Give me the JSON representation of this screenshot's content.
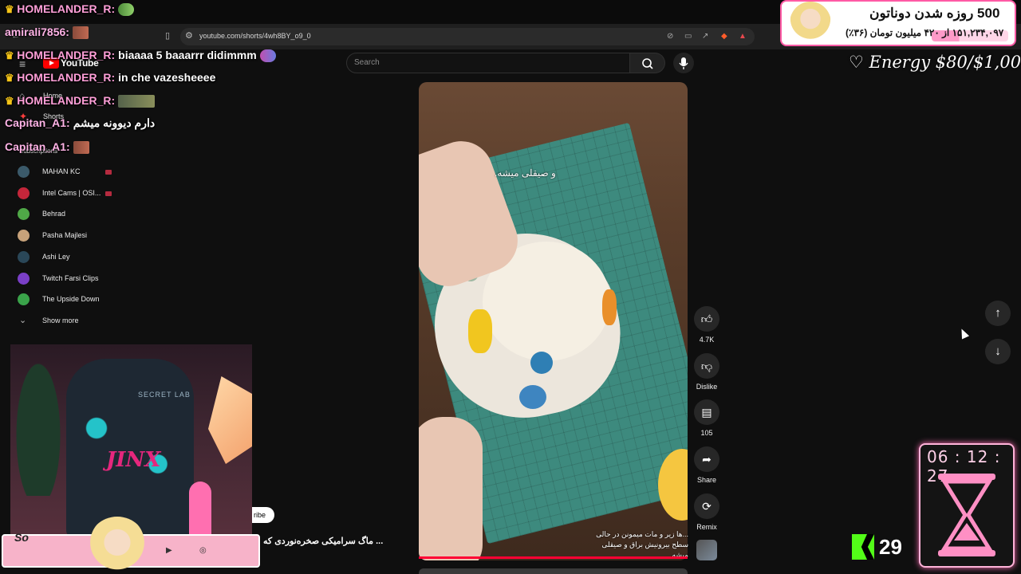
{
  "browser": {
    "tab_title": "(1) ماگ سرامیکی صخره‌نوردی",
    "url": "youtube.com/shorts/4wh8BY_o9_0"
  },
  "youtube": {
    "logo_text": "YouTube",
    "search_placeholder": "Search",
    "sidebar": {
      "home": "Home",
      "shorts": "Shorts",
      "subscriptions_heading": "Subscriptions",
      "subscriptions": [
        {
          "name": "MAHAN KC",
          "avatar_color": "#3b5a6a",
          "live": true
        },
        {
          "name": "Intel Cams | OSI...",
          "avatar_color": "#c4263a",
          "live": true
        },
        {
          "name": "Behrad",
          "avatar_color": "#4fa847",
          "live": false
        },
        {
          "name": "Pasha Majlesi",
          "avatar_color": "#c7a27a",
          "live": false
        },
        {
          "name": "Ashi Ley",
          "avatar_color": "#2a4758",
          "live": false
        },
        {
          "name": "Twitch Farsi Clips",
          "avatar_color": "#7a3fc7",
          "live": false
        },
        {
          "name": "The Upside Down",
          "avatar_color": "#3aa34a",
          "live": false
        }
      ],
      "show_more": "Show more"
    },
    "video": {
      "caption": "و صیقلی میشه.",
      "description": "...ها زیر و مات میمونن در حالی سطح بیرونیش براق و صیقلی میشه",
      "channel_title": "... ماگ سرامیکی صخره‌نوردی که"
    },
    "actions": {
      "likes": "4.7K",
      "dislike": "Dislike",
      "comments": "105",
      "share": "Share",
      "remix": "Remix"
    },
    "subscribe_fragment": "ribe"
  },
  "chat": [
    {
      "user": "HOMELANDER_R:",
      "message": "",
      "crown": true,
      "emote": "frog"
    },
    {
      "user": "amirali7856:",
      "message": "",
      "crown": false,
      "emote": "small"
    },
    {
      "user": "HOMELANDER_R:",
      "message": "biaaaa 5 baaarrr didimmm",
      "crown": true,
      "emote": "anime"
    },
    {
      "user": "HOMELANDER_R:",
      "message": "in che vazesheeee",
      "crown": true,
      "emote": ""
    },
    {
      "user": "HOMELANDER_R:",
      "message": "",
      "crown": true,
      "emote": "wide"
    },
    {
      "user": "Capitan_A1:",
      "message": "دارم دیوونه میشم",
      "crown": false,
      "emote": ""
    },
    {
      "user": "Capitan_A1:",
      "message": "",
      "crown": false,
      "emote": "small"
    }
  ],
  "donation": {
    "title": "500 روزه شدن دوناتون",
    "subtitle": "۱۵۱,۲۳۴,۰۹۷ از ۴۲۰ میلیون تومان (۳۶٪)",
    "goal_fraction": 0.36,
    "energy": "♡ Energy $80/$1,000"
  },
  "timer": {
    "time": "06 : 12 : 27"
  },
  "kick": {
    "viewer_count": "29"
  },
  "webcam": {
    "chair_brand": "SECRET LAB",
    "chair_text": "JINX"
  },
  "social": {
    "text": "So"
  },
  "colors": {
    "accent_red": "#ff0033",
    "kick_green": "#53fc18",
    "overlay_pink": "#ff9ac8"
  }
}
